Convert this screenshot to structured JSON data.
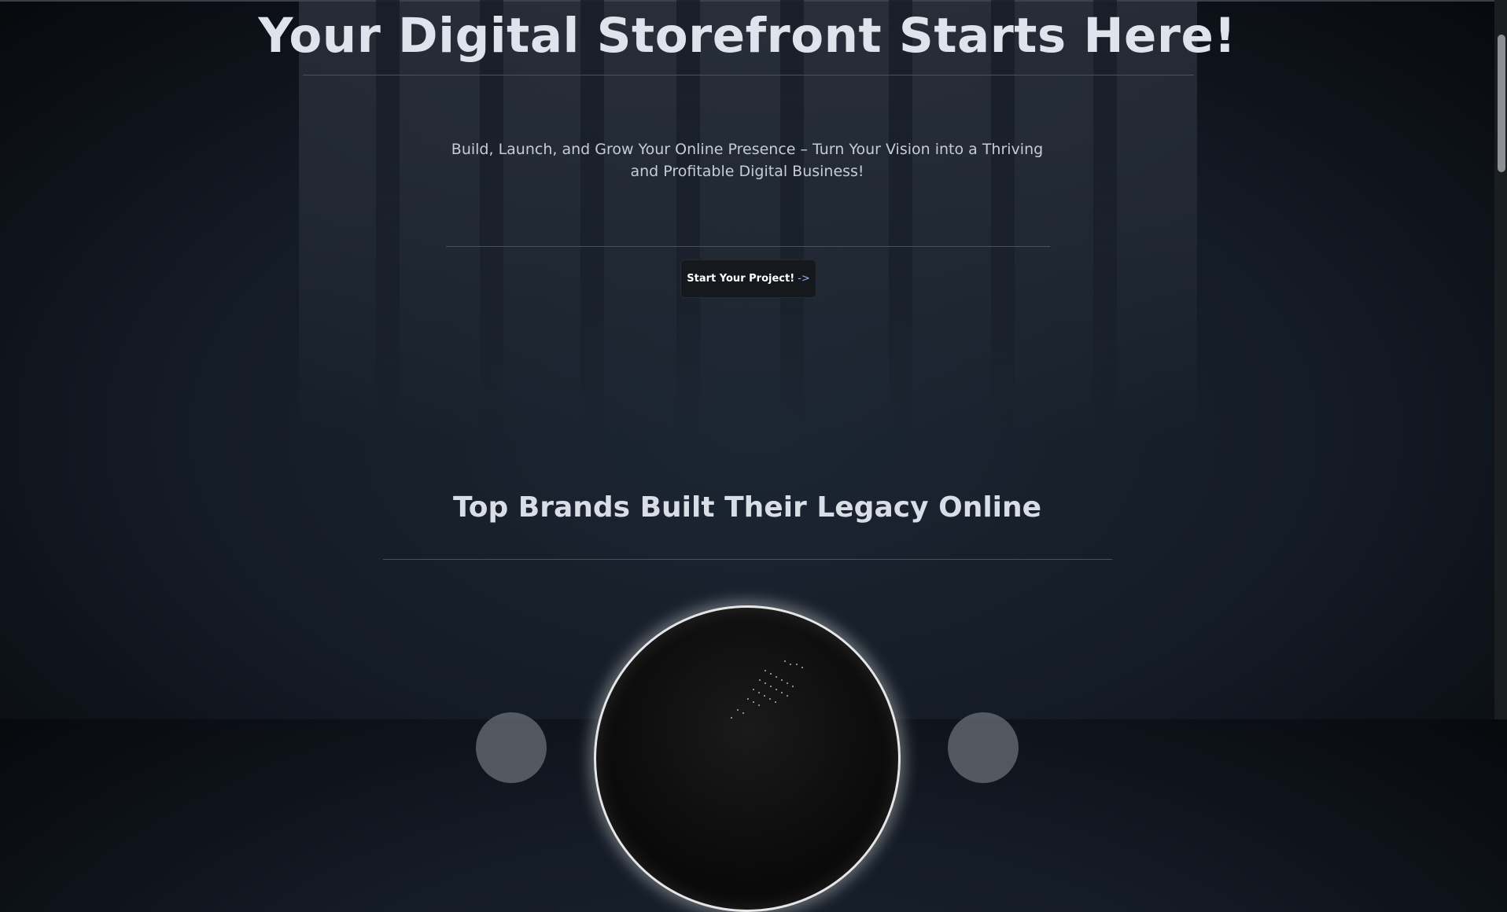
{
  "hero": {
    "title": "Your Digital Storefront Starts Here!",
    "tagline": "Build, Launch, and Grow Your Online Presence – Turn Your Vision into a Thriving and Profitable Digital Business!",
    "cta_label": "Start Your Project!",
    "cta_arrow": "->"
  },
  "brands": {
    "title": "Top Brands Built Their Legacy Online",
    "globe_icon": "globe-icon"
  },
  "colors": {
    "background": "#141b25",
    "text": "#dfe4ec",
    "button_bg": "#15181d",
    "arrow_accent": "#9ab4e6"
  }
}
